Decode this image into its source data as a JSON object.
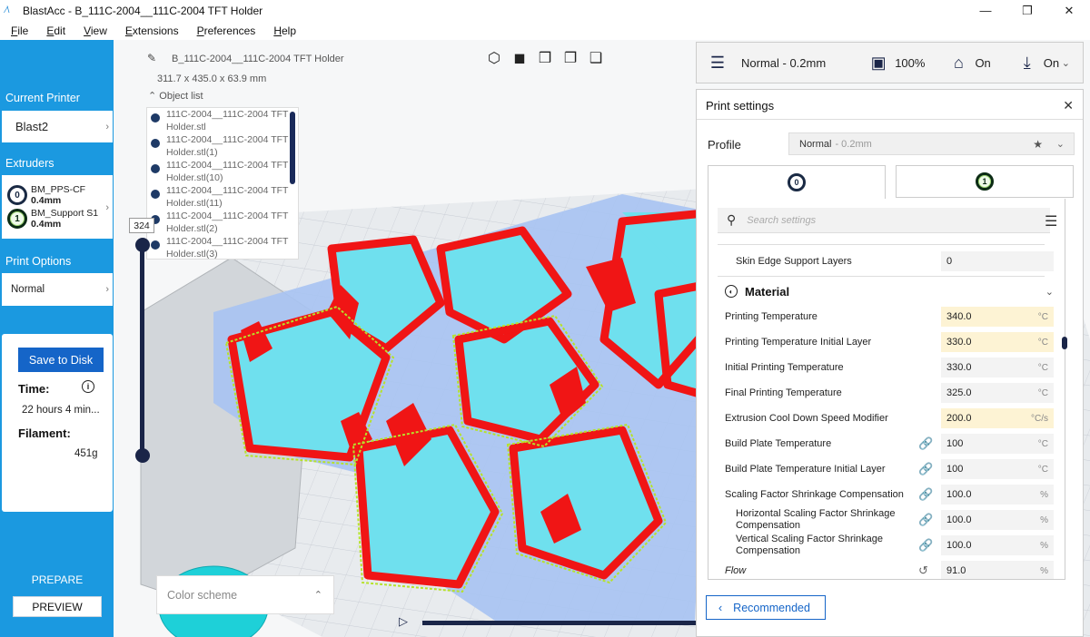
{
  "window": {
    "title": "BlastAcc - B_111C-2004__111C-2004 TFT Holder",
    "controls": {
      "minimize": "—",
      "maximize": "❐",
      "close": "✕"
    }
  },
  "menu": [
    {
      "label": "File",
      "key": "F",
      "rest": "ile"
    },
    {
      "label": "Edit",
      "key": "E",
      "rest": "dit"
    },
    {
      "label": "View",
      "key": "V",
      "rest": "iew"
    },
    {
      "label": "Extensions",
      "key": "E",
      "rest": "xtensions"
    },
    {
      "label": "Preferences",
      "key": "P",
      "rest": "references"
    },
    {
      "label": "Help",
      "key": "H",
      "rest": "elp"
    }
  ],
  "sidebar": {
    "current_printer_header": "Current Printer",
    "printer_name": "Blast2",
    "extruders_header": "Extruders",
    "extruders": [
      {
        "index": "0",
        "material": "BM_PPS-CF",
        "nozzle": "0.4mm"
      },
      {
        "index": "1",
        "material": "BM_Support S1",
        "nozzle": "0.4mm"
      }
    ],
    "print_options_header": "Print Options",
    "print_option_value": "Normal",
    "save_label": "Save to Disk",
    "time_label": "Time:",
    "time_value": "22 hours 4 min...",
    "filament_label": "Filament:",
    "filament_value": "451g",
    "stage_prepare": "PREPARE",
    "stage_preview": "PREVIEW"
  },
  "viewport": {
    "job_name": "B_111C-2004__111C-2004 TFT Holder",
    "dimensions": "311.7 x 435.0 x 63.9 mm",
    "object_list_label": "Object list",
    "objects": [
      {
        "line1": "111C-2004__111C-2004 TFT",
        "line2": "Holder.stl"
      },
      {
        "line1": "111C-2004__111C-2004 TFT",
        "line2": "Holder.stl(1)"
      },
      {
        "line1": "111C-2004__111C-2004 TFT",
        "line2": "Holder.stl(10)"
      },
      {
        "line1": "111C-2004__111C-2004 TFT",
        "line2": "Holder.stl(11)"
      },
      {
        "line1": "111C-2004__111C-2004 TFT",
        "line2": "Holder.stl(2)"
      },
      {
        "line1": "111C-2004__111C-2004 TFT",
        "line2": "Holder.stl(3)"
      }
    ],
    "layer_value": "324",
    "color_scheme_label": "Color scheme"
  },
  "quickbar": {
    "profile": "Normal - 0.2mm",
    "infill": "100%",
    "support": "On",
    "adhesion": "On"
  },
  "print_settings": {
    "title": "Print settings",
    "profile_label": "Profile",
    "profile_name": "Normal",
    "profile_suffix": "- 0.2mm",
    "tabs": [
      "0",
      "1"
    ],
    "search_placeholder": "Search settings",
    "skin_edge_label": "Skin Edge Support Layers",
    "skin_edge_value": "0",
    "section_title": "Material",
    "rows": [
      {
        "label": "Printing Temperature",
        "value": "340.0",
        "unit": "°C"
      },
      {
        "label": "Printing Temperature Initial Layer",
        "value": "330.0",
        "unit": "°C"
      },
      {
        "label": "Initial Printing Temperature",
        "value": "330.0",
        "unit": "°C"
      },
      {
        "label": "Final Printing Temperature",
        "value": "325.0",
        "unit": "°C"
      },
      {
        "label": "Extrusion Cool Down Speed Modifier",
        "value": "200.0",
        "unit": "°C/s"
      },
      {
        "label": "Build Plate Temperature",
        "value": "100",
        "unit": "°C"
      },
      {
        "label": "Build Plate Temperature Initial Layer",
        "value": "100",
        "unit": "°C"
      },
      {
        "label": "Scaling Factor Shrinkage Compensation",
        "value": "100.0",
        "unit": "%"
      },
      {
        "label1": "Horizontal Scaling Factor Shrinkage",
        "label2": "Compensation",
        "value": "100.0",
        "unit": "%"
      },
      {
        "label1": "Vertical Scaling Factor Shrinkage",
        "label2": "Compensation",
        "value": "100.0",
        "unit": "%"
      },
      {
        "label": "Flow",
        "value": "91.0",
        "unit": "%"
      }
    ],
    "recommended_label": "Recommended"
  },
  "colors": {
    "sidebar_blue": "#1b99e0",
    "accent_blue": "#1565c8",
    "navy": "#1a2548",
    "model_red": "#f01515",
    "support_cyan": "#6fe0ee",
    "warn_field": "#fdf3d4"
  },
  "icons": {
    "pen": "pen-icon",
    "settings_sliders": "sliders-icon",
    "infill": "infill-icon",
    "support": "support-icon",
    "adhesion": "adhesion-icon",
    "search": "search-icon",
    "menu": "hamburger-icon",
    "material": "material-icon",
    "link": "link-icon",
    "reset": "reset-icon"
  }
}
